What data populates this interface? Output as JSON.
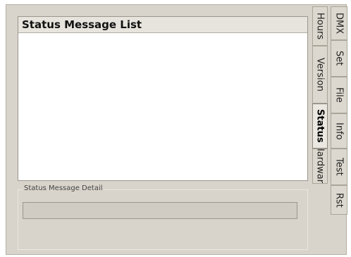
{
  "status_list": {
    "header": "Status Message List",
    "items": []
  },
  "status_detail": {
    "legend": "Status Message Detail",
    "value": ""
  },
  "inner_tabs": [
    {
      "label": "Hours",
      "active": false
    },
    {
      "label": "Version",
      "active": false
    },
    {
      "label": "Status",
      "active": true
    },
    {
      "label": "Hardware",
      "active": false
    }
  ],
  "outer_tabs": [
    {
      "label": "DMX"
    },
    {
      "label": "Set"
    },
    {
      "label": "File"
    },
    {
      "label": "Info"
    },
    {
      "label": "Test"
    },
    {
      "label": "Rst"
    }
  ]
}
